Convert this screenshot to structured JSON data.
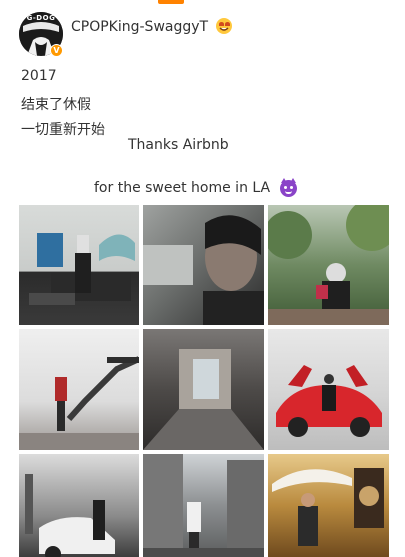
{
  "user": {
    "avatar_text": "G-DOG",
    "name": "CPOPKing-SwaggyT",
    "verified_badge": "V"
  },
  "post": {
    "lines": [
      "2017",
      "结束了休假",
      "一切重新开始",
      "Thanks Airbnb",
      "for the sweet home in LA"
    ]
  },
  "icons": {
    "name_emoji": "grinning-face-emoji",
    "text_emoji": "purple-devil-emoji"
  },
  "colors": {
    "accent": "#ff8200",
    "verified": "#ff9900",
    "devil": "#8a44c8"
  },
  "photos": [
    "living-room-with-person",
    "selfie-closeup",
    "garden-with-person",
    "staircase-with-person",
    "hallway-interior",
    "person-on-red-sports-car",
    "street-with-car",
    "street-building",
    "outdoor-umbrella-scene"
  ]
}
